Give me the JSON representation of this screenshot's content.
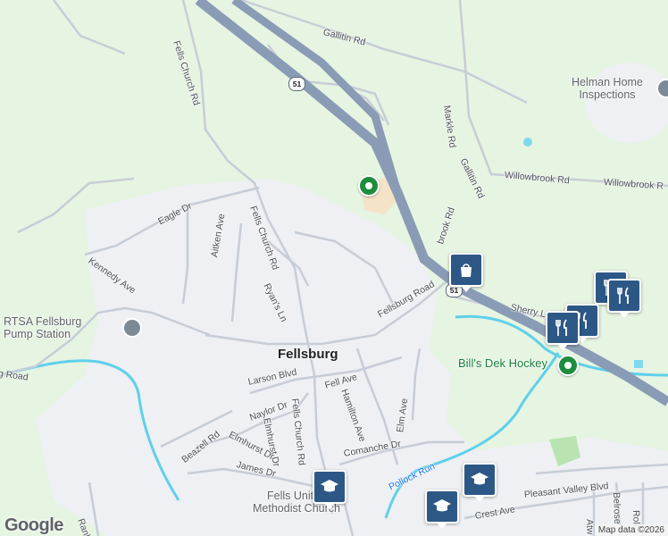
{
  "map": {
    "town_label": "Fellsburg",
    "route_shield": "51",
    "roads": {
      "fells_church_rd": "Fells Church Rd",
      "gallitin_rd": "Gallitin Rd",
      "markle_rd": "Markle Rd",
      "willowbrook_rd": "Willowbrook Rd",
      "willowbrook_rd_east": "Willowbrook R",
      "brook_rd_fragment": "brook Rd",
      "eagle_dr": "Eagle Dr",
      "kennedy_ave": "Kennedy Ave",
      "aitken_ave": "Aitken Ave",
      "ryans_ln": "Ryan's Ln",
      "fellsburg_road": "Fellsburg Road",
      "fellsburg_road_west": "g Road",
      "sherry_ln": "Sherry La",
      "larson_blvd": "Larson Blvd",
      "fell_ave": "Fell Ave",
      "hamilton_ave": "Hamilton Ave",
      "naylor_dr": "Naylor Dr",
      "elmhurst_dr": "Elmhurst Dr",
      "elmhurst_dr_2": "Elmhurst Dr",
      "beazell_rd": "Beazell Rd",
      "james_dr": "James Dr",
      "elm_ave": "Elm Ave",
      "comanche_dr": "Comanche Dr",
      "pollock_run": "Pollock Run",
      "crest_ave": "Crest Ave",
      "pleasant_valley_blvd": "Pleasant Valley Blvd",
      "rankin_rd": "Rankin Rd",
      "belrose": "Belrose",
      "atw": "Atw",
      "roll": "Roll"
    },
    "places": {
      "helman_line1": "Helman Home",
      "helman_line2": "Inspections",
      "rtsa_line1": "RTSA Fellsburg",
      "rtsa_line2": "Pump Station",
      "bills_dek_hockey": "Bill's Dek Hockey",
      "fells_united_line1": "Fells United",
      "fells_united_line2": "Methodist Church"
    },
    "markers": [
      {
        "type": "shopping",
        "icon": "shopping-bag-icon"
      },
      {
        "type": "restaurant",
        "icon": "fork-knife-icon"
      },
      {
        "type": "restaurant",
        "icon": "fork-knife-icon"
      },
      {
        "type": "restaurant",
        "icon": "fork-knife-icon"
      },
      {
        "type": "school",
        "icon": "graduation-cap-icon"
      },
      {
        "type": "school",
        "icon": "graduation-cap-icon"
      },
      {
        "type": "school",
        "icon": "graduation-cap-icon"
      }
    ],
    "logo": "Google",
    "attribution": "Map data ©2026"
  },
  "colors": {
    "land_green": "#e6f4e2",
    "urban_gray": "#eef0f3",
    "highway": "#8a9cb5",
    "water": "#5fd0ea",
    "pin_blue": "#2d5886"
  }
}
